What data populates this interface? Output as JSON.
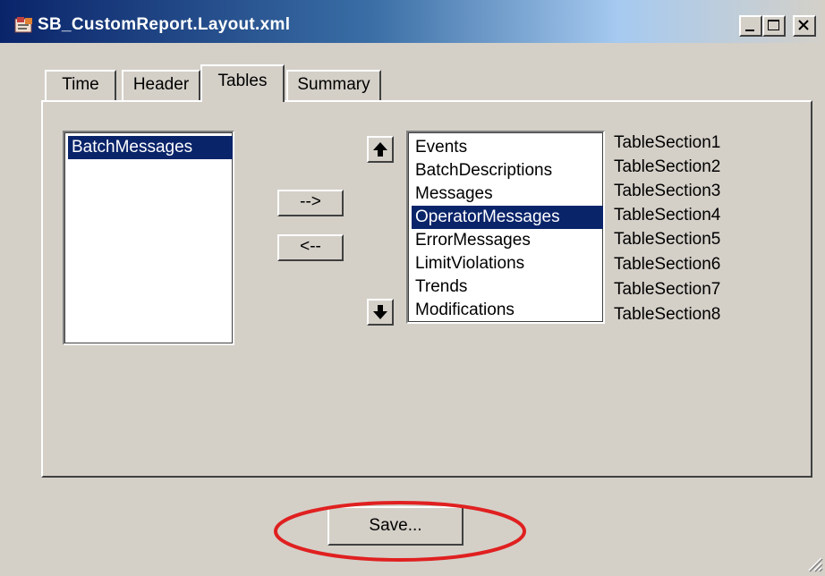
{
  "window": {
    "title": "SB_CustomReport.Layout.xml"
  },
  "icons": {
    "app": "app-icon",
    "minimize": "minimize-icon",
    "maximize": "maximize-icon",
    "close": "close-icon",
    "move_up": "arrow-up-icon",
    "move_down": "arrow-down-icon",
    "resize": "resize-grip-icon"
  },
  "tabs": [
    {
      "label": "Time",
      "active": false
    },
    {
      "label": "Header",
      "active": false
    },
    {
      "label": "Tables",
      "active": true
    },
    {
      "label": "Summary",
      "active": false
    }
  ],
  "available_list": {
    "items": [
      "BatchMessages"
    ],
    "selected": "BatchMessages"
  },
  "buttons": {
    "add": "-->",
    "remove": "<--",
    "save": "Save..."
  },
  "selected_list": {
    "items": [
      "Events",
      "BatchDescriptions",
      "Messages",
      "OperatorMessages",
      "ErrorMessages",
      "LimitViolations",
      "Trends",
      "Modifications"
    ],
    "selected": "OperatorMessages"
  },
  "section_labels": [
    "TableSection1",
    "TableSection2",
    "TableSection3",
    "TableSection4",
    "TableSection5",
    "TableSection6",
    "TableSection7",
    "TableSection8"
  ],
  "colors": {
    "selection": "#0a246a",
    "annotation": "#e02020",
    "face": "#d4d0c8"
  }
}
